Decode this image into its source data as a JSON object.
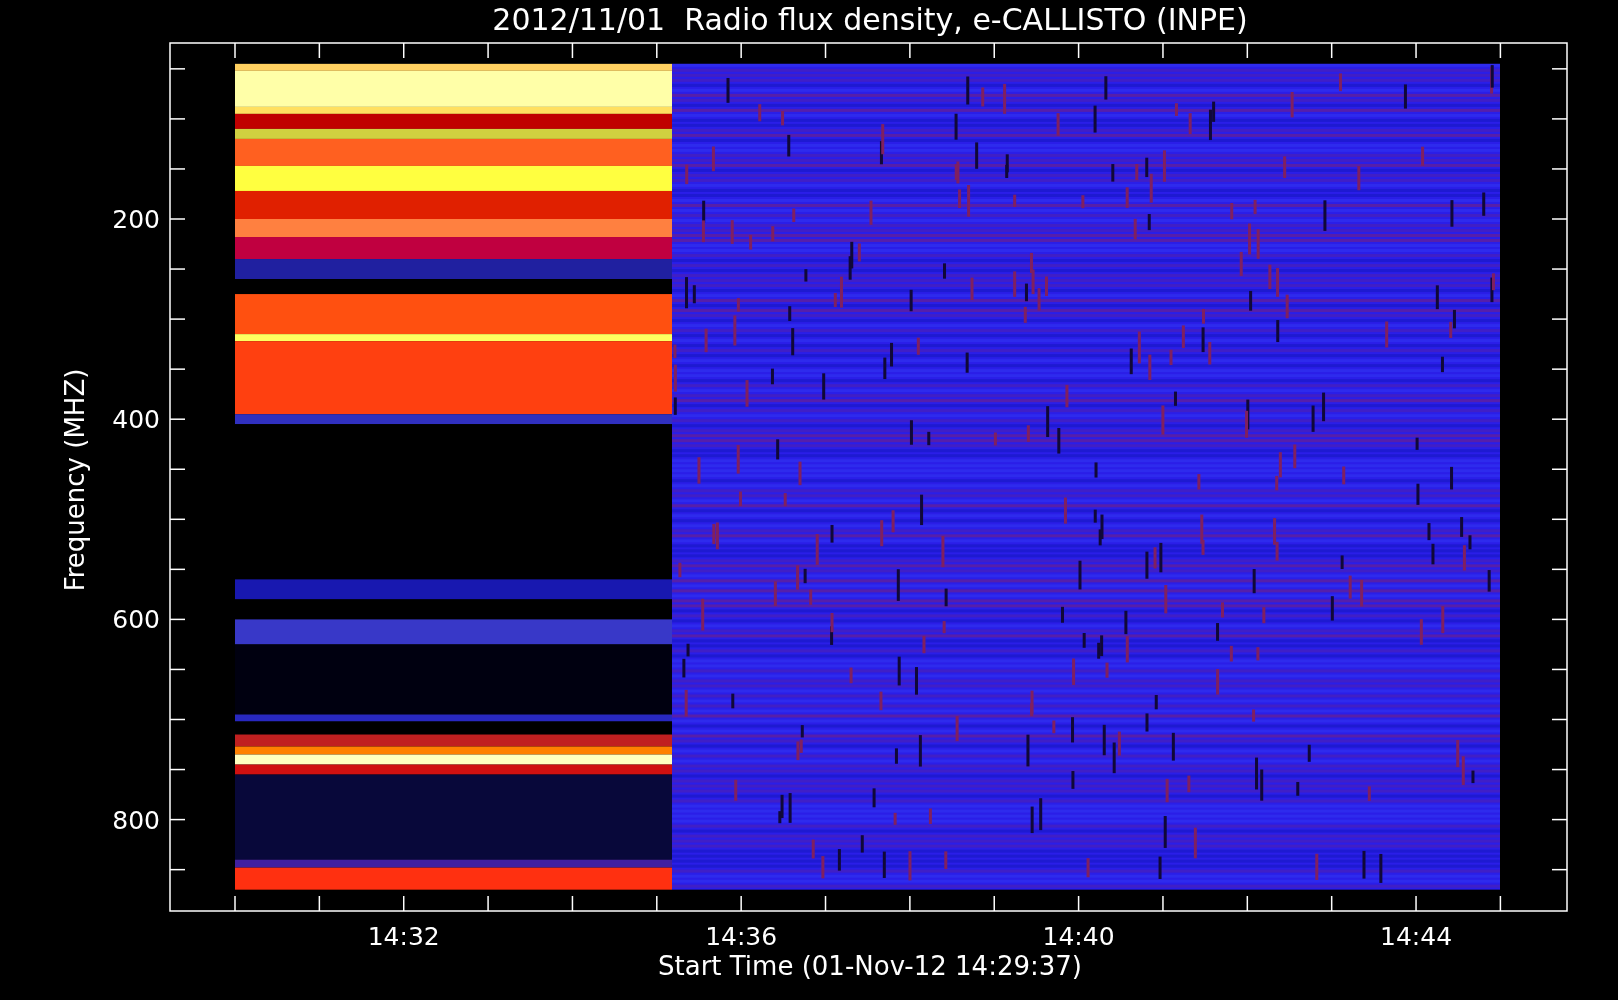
{
  "title": "2012/11/01  Radio flux density, e-CALLISTO (INPE)",
  "y_axis": {
    "label": "Frequency (MHZ)",
    "ticks": [
      "200",
      "400",
      "600",
      "800"
    ]
  },
  "x_axis": {
    "label": "Start Time (01-Nov-12 14:29:37)",
    "ticks": [
      "14:32",
      "14:36",
      "14:40",
      "14:44"
    ]
  }
}
